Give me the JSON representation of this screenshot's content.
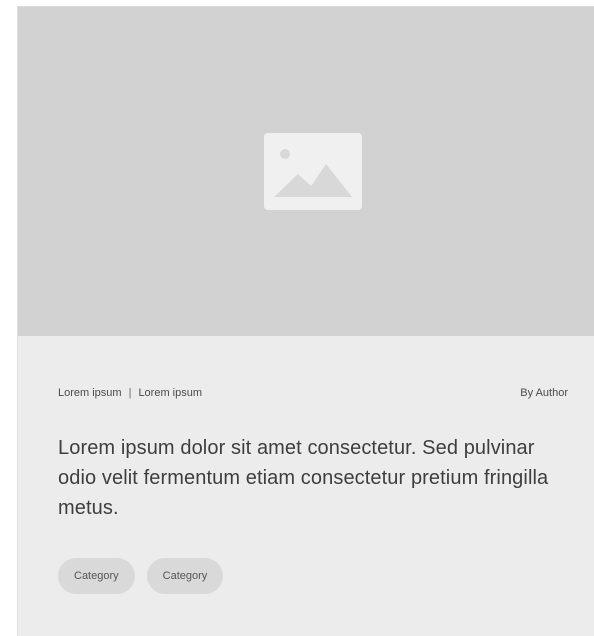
{
  "card": {
    "image": {
      "icon": "image-placeholder-icon"
    },
    "meta": {
      "left_1": "Lorem ipsum",
      "separator": "|",
      "left_2": "Lorem ipsum",
      "author": "By Author"
    },
    "headline": "Lorem ipsum dolor sit amet consectetur. Sed pulvinar odio velit fermentum etiam consectetur pretium fringilla metus.",
    "tags": [
      {
        "label": "Category"
      },
      {
        "label": "Category"
      }
    ]
  },
  "colors": {
    "card_background": "#ececec",
    "image_background": "#d2d2d2",
    "icon": "#f0f0f0",
    "text": "#3e3e3e",
    "tag_background": "#d9d9d9"
  }
}
